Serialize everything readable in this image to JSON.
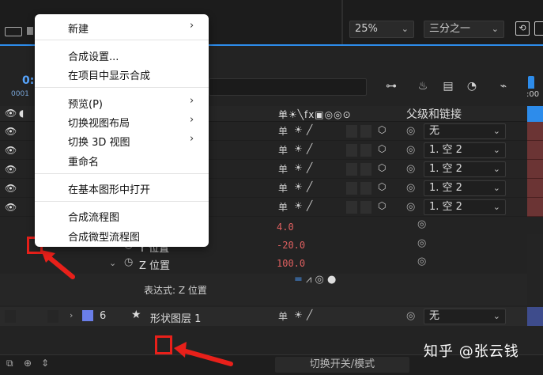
{
  "toolbar": {
    "zoom_value": "25%",
    "resolution_value": "三分之一"
  },
  "timeline": {
    "time_prefix": "0:",
    "frame_prefix": "0001",
    "zero_label": ":00"
  },
  "header": {
    "switch_icons": "单☀╲fx▣◎◎⊙",
    "parent_label": "父级和链接"
  },
  "layers": [
    {
      "parent": "无"
    },
    {
      "parent": "1. 空 2"
    },
    {
      "parent": "1. 空 2"
    },
    {
      "parent": "1. 空 2"
    },
    {
      "parent": "1. 空 2"
    }
  ],
  "properties": {
    "x_value": "4.0",
    "y_label": "Y 位置",
    "y_value": "-20.0",
    "z_label": "Z 位置",
    "z_value": "100.0",
    "expression_label": "表达式: Z 位置"
  },
  "layer6": {
    "number": "6",
    "name": "形状图层 1",
    "parent": "无"
  },
  "bottom": {
    "toggle_label": "切换开关/模式"
  },
  "watermark": "知乎 @张云钱",
  "context_menu": {
    "items": [
      {
        "label": "新建",
        "submenu": true
      },
      {
        "label": "合成设置...",
        "submenu": false
      },
      {
        "label": "在项目中显示合成",
        "submenu": false
      },
      {
        "label": "预览(P)",
        "submenu": true
      },
      {
        "label": "切换视图布局",
        "submenu": true
      },
      {
        "label": "切换 3D 视图",
        "submenu": true
      },
      {
        "label": "重命名",
        "submenu": false
      },
      {
        "label": "在基本图形中打开",
        "submenu": false
      },
      {
        "label": "合成流程图",
        "submenu": false
      },
      {
        "label": "合成微型流程图",
        "submenu": false
      }
    ]
  },
  "colors": {
    "accent": "#2d8ceb",
    "annotation_red": "#e8201a",
    "label_blue": "#6a7ee8",
    "track_red": "#6b3434"
  }
}
